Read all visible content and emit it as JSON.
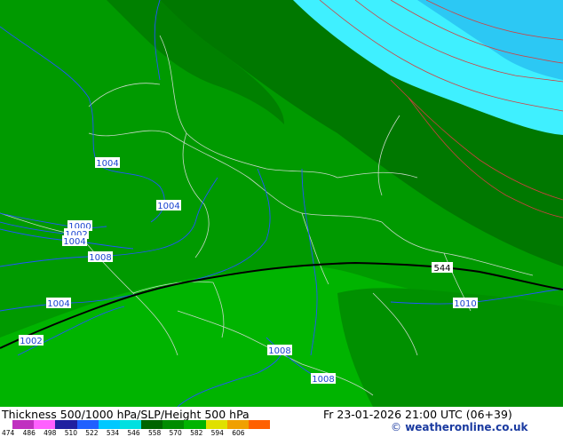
{
  "map": {
    "isobar_labels": [
      "1004",
      "1004",
      "1000",
      "1002",
      "1004",
      "1008",
      "1004",
      "1002",
      "1008",
      "1008",
      "1010"
    ],
    "thickness_label": "544"
  },
  "footer": {
    "title": "Thickness 500/1000 hPa/SLP/Height 500 hPa",
    "datetime": "Fr 23-01-2026 21:00 UTC (06+39)",
    "credit": "weatheronline.co.uk",
    "credit_symbol": "©"
  },
  "legend": {
    "ticks": [
      "474",
      "486",
      "498",
      "510",
      "522",
      "534",
      "546",
      "558",
      "570",
      "582",
      "594",
      "606"
    ],
    "colors": [
      "#c030c0",
      "#ff60ff",
      "#2020a0",
      "#2060ff",
      "#00c8ff",
      "#00e0e0",
      "#006400",
      "#008c00",
      "#00b400",
      "#e0e000",
      "#f0a000",
      "#ff6000"
    ]
  },
  "colors": {
    "dark_green": "#007800",
    "medium_green": "#009a00",
    "light_green": "#00b400",
    "cyan": "#3ff0ff",
    "light_blue": "#2cc8f4",
    "isobar": "#2255ff",
    "border": "#c8d8c8",
    "contour_red": "#d04040"
  }
}
